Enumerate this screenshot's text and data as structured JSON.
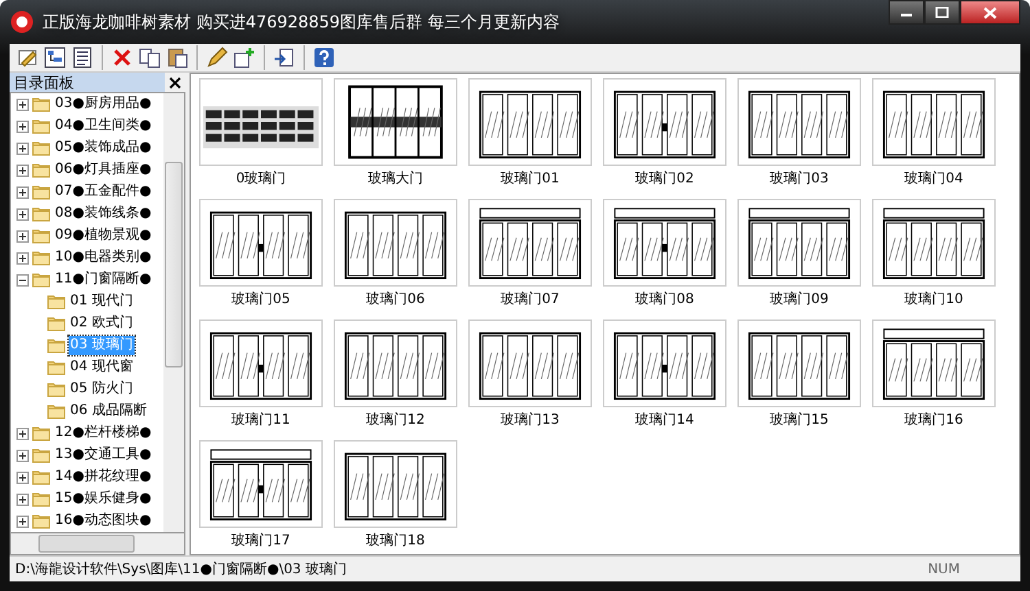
{
  "window": {
    "title": "正版海龙咖啡树素材 购买进476928859图库售后群 每三个月更新内容"
  },
  "toolbar": {
    "buttons": [
      {
        "kind": "pencil"
      },
      {
        "kind": "tree"
      },
      {
        "kind": "list"
      },
      {
        "kind": "sep"
      },
      {
        "kind": "delete"
      },
      {
        "kind": "copy"
      },
      {
        "kind": "paste"
      },
      {
        "kind": "sep"
      },
      {
        "kind": "edit"
      },
      {
        "kind": "add"
      },
      {
        "kind": "sep"
      },
      {
        "kind": "export"
      },
      {
        "kind": "sep"
      },
      {
        "kind": "help"
      }
    ]
  },
  "sidebar": {
    "title": "目录面板",
    "items": [
      {
        "label": "03●厨房用品●",
        "expanded": false,
        "selected": false
      },
      {
        "label": "04●卫生间类●",
        "expanded": false,
        "selected": false
      },
      {
        "label": "05●装饰成品●",
        "expanded": false,
        "selected": false
      },
      {
        "label": "06●灯具插座●",
        "expanded": false,
        "selected": false
      },
      {
        "label": "07●五金配件●",
        "expanded": false,
        "selected": false
      },
      {
        "label": "08●装饰线条●",
        "expanded": false,
        "selected": false
      },
      {
        "label": "09●植物景观●",
        "expanded": false,
        "selected": false
      },
      {
        "label": "10●电器类别●",
        "expanded": false,
        "selected": false
      },
      {
        "label": "11●门窗隔断●",
        "expanded": true,
        "selected": false,
        "children": [
          {
            "label": "01 现代门",
            "selected": false
          },
          {
            "label": "02 欧式门",
            "selected": false
          },
          {
            "label": "03 玻璃门",
            "selected": true
          },
          {
            "label": "04 现代窗",
            "selected": false
          },
          {
            "label": "05 防火门",
            "selected": false
          },
          {
            "label": "06 成品隔断",
            "selected": false
          }
        ]
      },
      {
        "label": "12●栏杆楼梯●",
        "expanded": false,
        "selected": false
      },
      {
        "label": "13●交通工具●",
        "expanded": false,
        "selected": false
      },
      {
        "label": "14●拼花纹理●",
        "expanded": false,
        "selected": false
      },
      {
        "label": "15●娱乐健身●",
        "expanded": false,
        "selected": false
      },
      {
        "label": "16●动态图块●",
        "expanded": false,
        "selected": false
      }
    ]
  },
  "gallery": {
    "items": [
      {
        "label": "0玻璃门",
        "kind": "sheet"
      },
      {
        "label": "玻璃大门",
        "kind": "dark"
      },
      {
        "label": "玻璃门01",
        "kind": "door"
      },
      {
        "label": "玻璃门02",
        "kind": "door"
      },
      {
        "label": "玻璃门03",
        "kind": "door"
      },
      {
        "label": "玻璃门04",
        "kind": "door"
      },
      {
        "label": "玻璃门05",
        "kind": "door"
      },
      {
        "label": "玻璃门06",
        "kind": "door"
      },
      {
        "label": "玻璃门07",
        "kind": "transom"
      },
      {
        "label": "玻璃门08",
        "kind": "transom"
      },
      {
        "label": "玻璃门09",
        "kind": "transom"
      },
      {
        "label": "玻璃门10",
        "kind": "transom"
      },
      {
        "label": "玻璃门11",
        "kind": "door"
      },
      {
        "label": "玻璃门12",
        "kind": "door"
      },
      {
        "label": "玻璃门13",
        "kind": "door"
      },
      {
        "label": "玻璃门14",
        "kind": "door"
      },
      {
        "label": "玻璃门15",
        "kind": "door"
      },
      {
        "label": "玻璃门16",
        "kind": "transom"
      },
      {
        "label": "玻璃门17",
        "kind": "transom"
      },
      {
        "label": "玻璃门18",
        "kind": "door"
      }
    ]
  },
  "status_bar": {
    "path": "D:\\海龍设计软件\\Sys\\图库\\11●门窗隔断●\\03 玻璃门",
    "indicator": "NUM"
  }
}
